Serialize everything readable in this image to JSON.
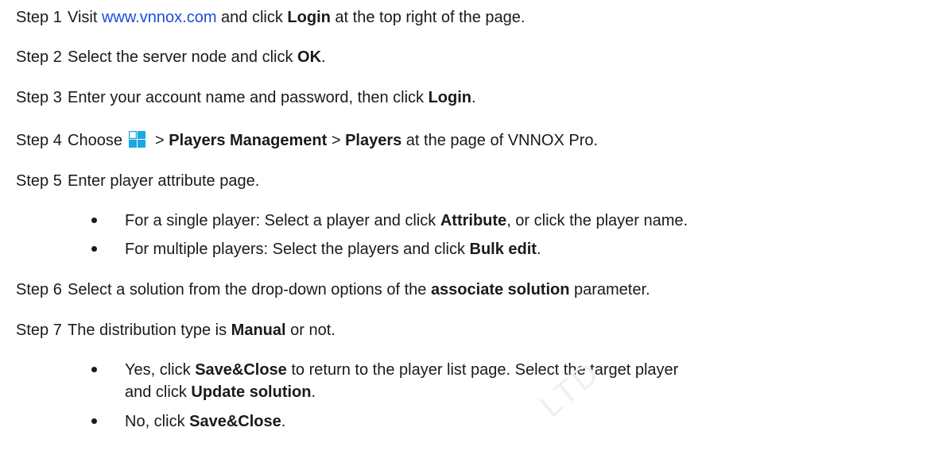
{
  "watermark": "LTD",
  "steps": [
    {
      "num": "Step 1",
      "pre": "Visit ",
      "link": "www.vnnox.com",
      "mid": " and click ",
      "bold": "Login",
      "post": " at the top right of the page."
    },
    {
      "num": "Step 2",
      "pre": "Select the server node and click ",
      "bold": "OK",
      "post": "."
    },
    {
      "num": "Step 3",
      "pre": "Enter your account name and password, then click ",
      "bold": "Login",
      "post": "."
    },
    {
      "num": "Step 4",
      "pre": "Choose ",
      "icon": "menu-grid-icon",
      "sep1": " > ",
      "bold1": "Players Management",
      "sep2": " > ",
      "bold2": "Players",
      "post": " at the page of VNNOX Pro."
    },
    {
      "num": "Step 5",
      "text": "Enter player attribute page.",
      "bullets": [
        {
          "pre": "For a single player: Select a player and click ",
          "bold": "Attribute",
          "post": ", or click the player name."
        },
        {
          "pre": "For multiple players: Select the players and click ",
          "bold": "Bulk edit",
          "post": "."
        }
      ]
    },
    {
      "num": "Step 6",
      "pre": "Select a solution from the drop-down options of the ",
      "bold": "associate solution",
      "post": " parameter."
    },
    {
      "num": "Step 7",
      "pre": "The distribution type is ",
      "bold": "Manual",
      "post": " or not.",
      "bullets": [
        {
          "pre": "Yes, click ",
          "bold": "Save&Close",
          "post": " to return to the player list page. Select the target player",
          "line2_pre": "and click ",
          "line2_bold": "Update solution",
          "line2_post": "."
        },
        {
          "pre": "No, click ",
          "bold": "Save&Close",
          "post": "."
        }
      ]
    }
  ],
  "colors": {
    "text": "#1a1a1a",
    "link": "#1a4fdc",
    "icon": "#1aa8e0"
  }
}
